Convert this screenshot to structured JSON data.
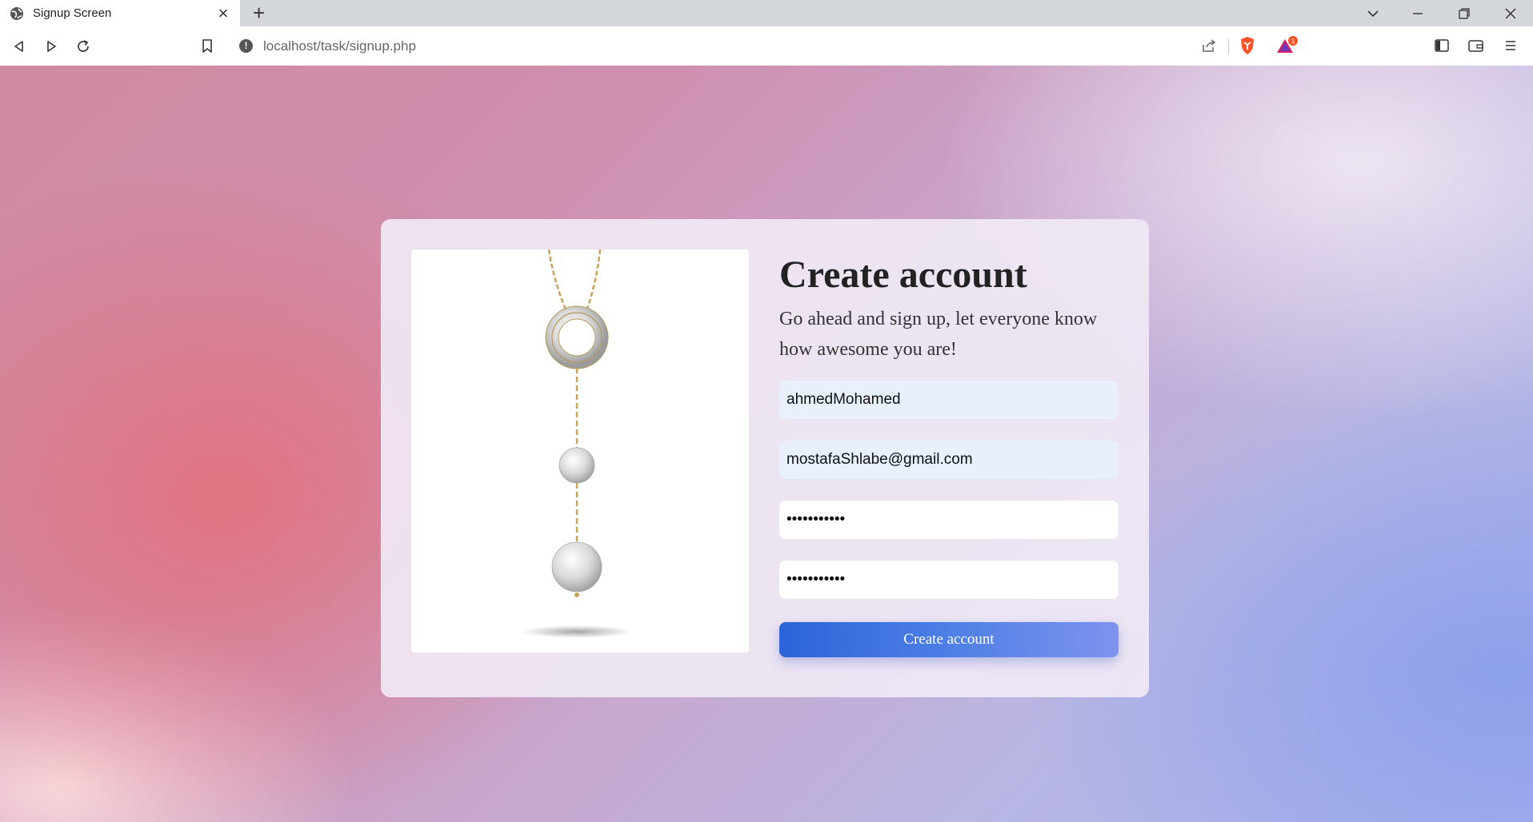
{
  "browser": {
    "tab_title": "Signup Screen",
    "url": "localhost/task/signup.php",
    "notification_count": "1"
  },
  "signup": {
    "title": "Create account",
    "subtitle": "Go ahead and sign up, let everyone know how awesome you are!",
    "username_value": "ahmedMohamed",
    "email_value": "mostafaShlabe@gmail.com",
    "password_value": "•••••••••••",
    "confirm_password_value": "•••••••••••",
    "submit_label": "Create account"
  },
  "colors": {
    "accent": "#2c63d8",
    "card_background": "#f0e8f4",
    "autofill_background": "#e8f0fe"
  },
  "icons": {
    "tab": "globe-icon",
    "back": "back-arrow-icon",
    "forward": "forward-arrow-icon",
    "reload": "reload-icon",
    "bookmark": "bookmark-icon",
    "share": "share-icon",
    "brave": "brave-shield-icon",
    "rewards": "brave-rewards-icon",
    "sidebar": "sidebar-icon",
    "wallet": "wallet-icon",
    "menu": "menu-icon"
  }
}
